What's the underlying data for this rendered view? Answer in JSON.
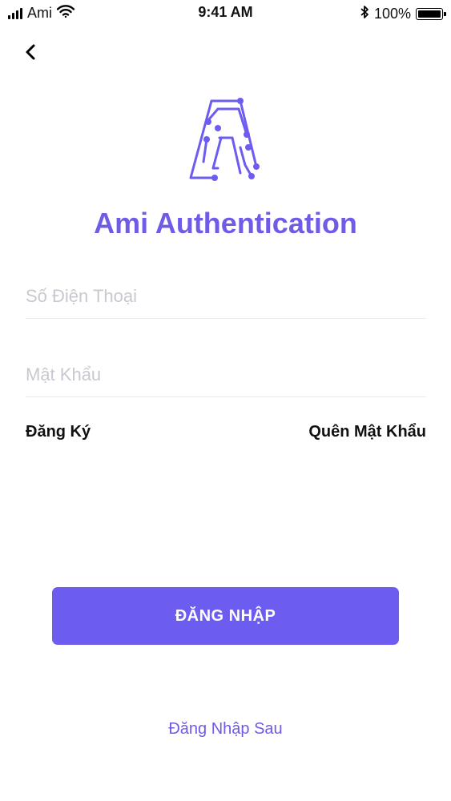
{
  "status_bar": {
    "carrier": "Ami",
    "time": "9:41 AM",
    "battery": "100%",
    "icons": [
      "signal-icon",
      "wifi-icon",
      "bluetooth-icon",
      "battery-icon"
    ]
  },
  "nav": {
    "back_icon": "chevron-left-icon"
  },
  "logo": {
    "icon": "ami-logo-icon"
  },
  "title": "Ami Authentication",
  "form": {
    "phone_placeholder": "Số Điện Thoại",
    "phone_value": "",
    "password_placeholder": "Mật Khẩu",
    "password_value": ""
  },
  "links": {
    "register": "Đăng Ký",
    "forgot_password": "Quên Mật Khẩu"
  },
  "login_button": "ĐĂNG NHẬP",
  "login_later": "Đăng Nhập Sau",
  "colors": {
    "accent": "#6c5cf0",
    "title": "#6f5ce6",
    "placeholder": "#c8c8d0",
    "divider": "#e9e9ef"
  }
}
